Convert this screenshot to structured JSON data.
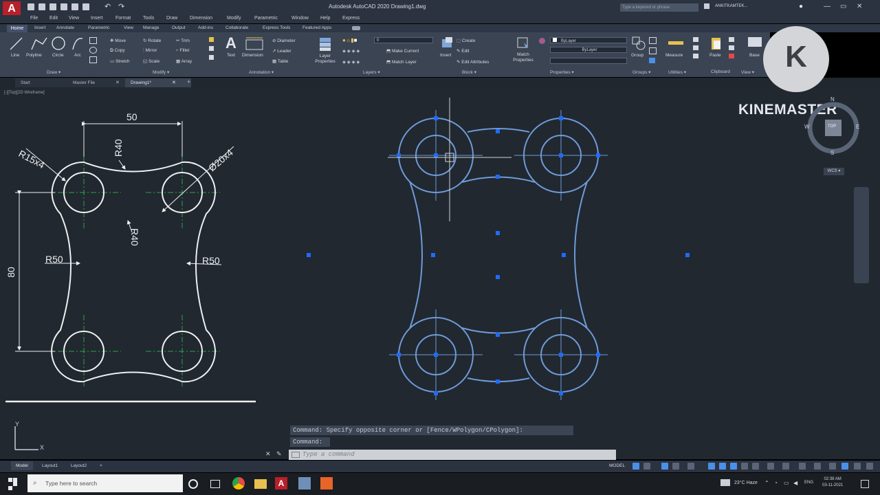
{
  "app": {
    "logo_letter": "A",
    "title": "Autodesk AutoCAD 2020   Drawing1.dwg",
    "search_placeholder": "Type a keyword or phrase",
    "user": "ANKITKAMTEK...",
    "window_controls": [
      "—",
      "▭",
      "✕"
    ]
  },
  "menus": [
    "File",
    "Edit",
    "View",
    "Insert",
    "Format",
    "Tools",
    "Draw",
    "Dimension",
    "Modify",
    "Parametric",
    "Window",
    "Help",
    "Express"
  ],
  "ribbon_tabs": [
    "Home",
    "Insert",
    "Annotate",
    "Parametric",
    "View",
    "Manage",
    "Output",
    "Add-ins",
    "Collaborate",
    "Express Tools",
    "Featured Apps"
  ],
  "ribbon": {
    "draw": {
      "line": "Line",
      "polyline": "Polyline",
      "circle": "Circle",
      "arc": "Arc",
      "title": "Draw ▾"
    },
    "modify": {
      "move": "Move",
      "rotate": "Rotate",
      "trim": "Trim",
      "copy": "Copy",
      "mirror": "Mirror",
      "fillet": "Fillet",
      "stretch": "Stretch",
      "scale": "Scale",
      "array": "Array",
      "title": "Modify ▾"
    },
    "annotation": {
      "text": "Text",
      "dimension": "Dimension",
      "diameter": "Diameter",
      "leader": "Leader",
      "table": "Table",
      "title": "Annotation ▾"
    },
    "layers": {
      "layer_properties": "Layer Properties",
      "current_layer": "0",
      "make_current": "Make Current",
      "match_layer": "Match Layer",
      "title": "Layers ▾"
    },
    "block": {
      "insert": "Insert",
      "create": "Create",
      "edit": "Edit",
      "edit_attributes": "Edit Attributes",
      "title": "Block ▾"
    },
    "properties": {
      "match_properties": "Match Properties",
      "bylayer1": "ByLayer",
      "bylayer2": "ByLayer",
      "title": "Properties ▾"
    },
    "groups": {
      "group": "Group",
      "title": "Groups ▾"
    },
    "utilities": {
      "measure": "Measure",
      "title": "Utilities ▾"
    },
    "clipboard": {
      "paste": "Paste",
      "title": "Clipboard"
    },
    "view": {
      "base": "Base",
      "title": "View ▾"
    }
  },
  "file_tabs": [
    "Start",
    "Master File",
    "Drawing1*"
  ],
  "viewport_label": "[-][Top][2D Wireframe]",
  "watermark": "KINEMASTER",
  "watermark_logo_letter": "K",
  "viewcube": {
    "n": "N",
    "s": "S",
    "e": "E",
    "w": "W",
    "top": "TOP",
    "wcs": "WCS ▾"
  },
  "reference_dims": {
    "width": "50",
    "height": "80",
    "r15": "R15x4",
    "r40_top": "R40",
    "d20": "Ø20x4",
    "r40_mid": "R40",
    "r50_left": "R50",
    "r50_right": "R50"
  },
  "ucs": {
    "x": "X",
    "y": "Y"
  },
  "command": {
    "history1": "Command: Specify opposite corner or [Fence/WPolygon/CPolygon]:",
    "history2": "Command:",
    "placeholder": "Type a command"
  },
  "layout_tabs": [
    "Model",
    "Layout1",
    "Layout2",
    "+"
  ],
  "status": {
    "model": "MODEL"
  },
  "taskbar": {
    "search_placeholder": "Type here to search",
    "weather": "23°C Haze",
    "lang": "ENG",
    "time": "02:38 AM",
    "date": "03-11-2021"
  },
  "colors": {
    "canvas": "#212830",
    "selection_blue": "#4a90e8",
    "grip_blue": "#1f6bff",
    "centerline_green": "#2aa34a"
  }
}
